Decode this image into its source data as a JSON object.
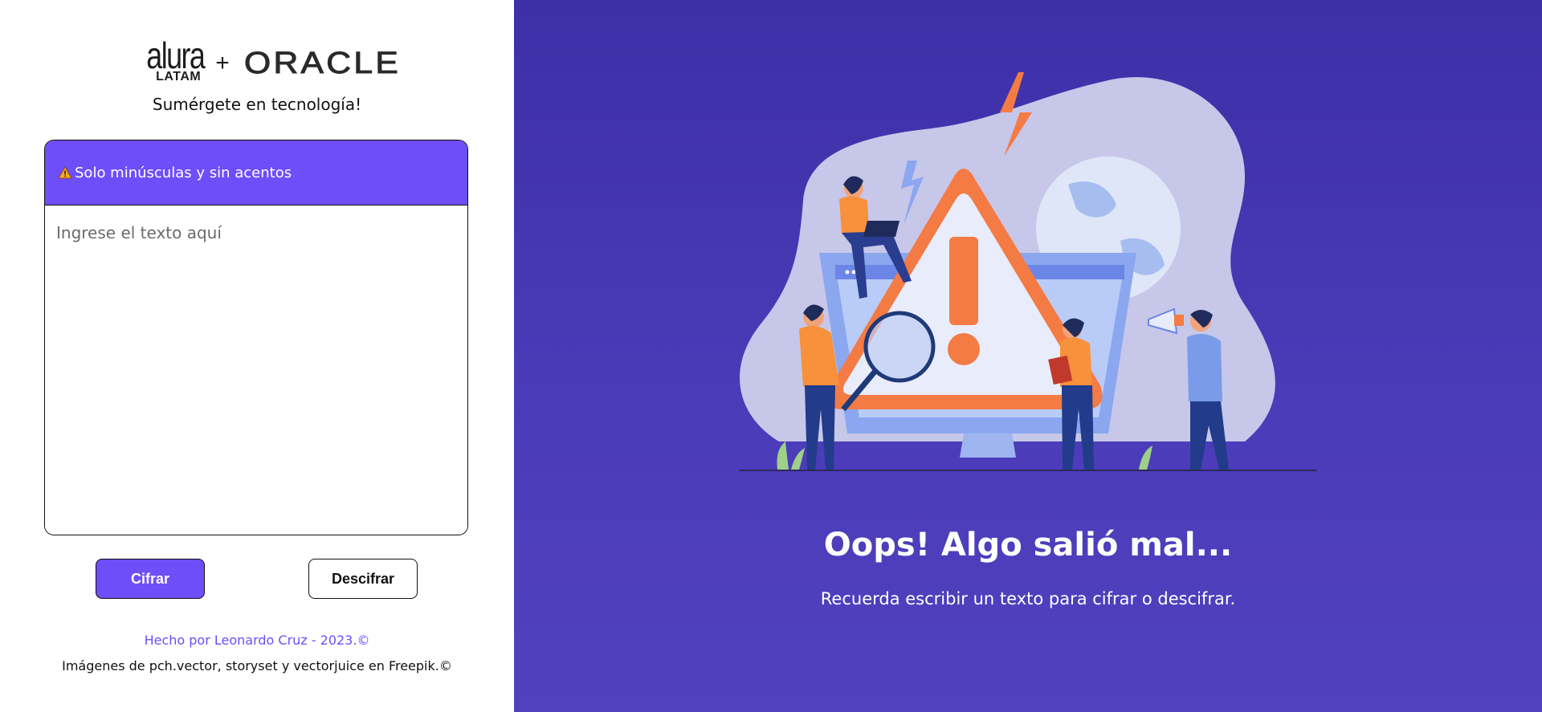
{
  "brand": {
    "alura_main": "alura",
    "alura_sub": "LATAM",
    "plus": "+",
    "oracle": "ORACLE",
    "tagline": "Sumérgete en tecnología!"
  },
  "input_card": {
    "warning": "Solo minúsculas y sin acentos",
    "warning_icon": "warning-icon",
    "placeholder": "Ingrese el texto aquí",
    "value": ""
  },
  "actions": {
    "encrypt_label": "Cifrar",
    "decrypt_label": "Descifrar"
  },
  "footer": {
    "credit": "Hecho por Leonardo Cruz - 2023.©",
    "images_credit": "Imágenes de pch.vector, storyset y vectorjuice en Freepik.©"
  },
  "result": {
    "title": "Oops! Algo salió mal...",
    "message": "Recuerda escribir un texto para cifrar o descifrar."
  },
  "colors": {
    "accent": "#6e4ef8",
    "panel_top": "#3d2fa6",
    "panel_bottom": "#5141bf",
    "warning_orange": "#f47b44"
  }
}
